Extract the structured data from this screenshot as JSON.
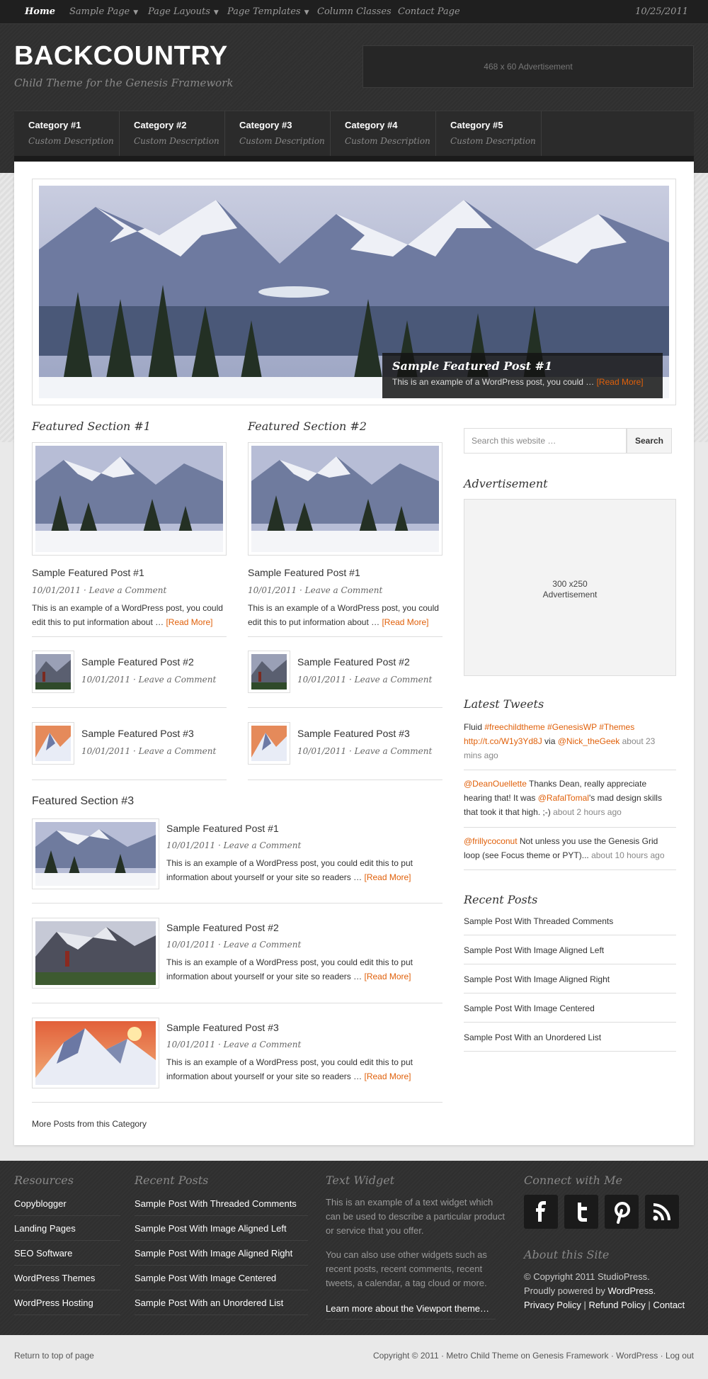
{
  "topnav": {
    "items": [
      {
        "label": "Home",
        "dropdown": false
      },
      {
        "label": "Sample Page",
        "dropdown": true
      },
      {
        "label": "Page Layouts",
        "dropdown": true
      },
      {
        "label": "Page Templates",
        "dropdown": true
      },
      {
        "label": "Column Classes",
        "dropdown": false
      },
      {
        "label": "Contact Page",
        "dropdown": false
      }
    ],
    "date": "10/25/2011"
  },
  "header": {
    "title": "BACKCOUNTRY",
    "description": "Child Theme for the Genesis Framework",
    "ad": "468 x 60 Advertisement"
  },
  "catnav": [
    {
      "title": "Category #1",
      "desc": "Custom Description"
    },
    {
      "title": "Category #2",
      "desc": "Custom Description"
    },
    {
      "title": "Category #3",
      "desc": "Custom Description"
    },
    {
      "title": "Category #4",
      "desc": "Custom Description"
    },
    {
      "title": "Category #5",
      "desc": "Custom Description"
    }
  ],
  "slider": {
    "title": "Sample Featured Post #1",
    "excerpt": "This is an example of a WordPress post, you could …",
    "read_more": "[Read More]"
  },
  "featured1": {
    "heading": "Featured Section #1",
    "main": {
      "title": "Sample Featured Post #1",
      "date": "10/01/2011",
      "comment": "Leave a Comment",
      "excerpt1": "This is an example of a WordPress post, you could",
      "excerpt2": "edit this to put information about …",
      "read_more": "[Read More]"
    },
    "list": [
      {
        "title": "Sample Featured Post #2",
        "date": "10/01/2011",
        "comment": "Leave a Comment"
      },
      {
        "title": "Sample Featured Post #3",
        "date": "10/01/2011",
        "comment": "Leave a Comment"
      }
    ]
  },
  "featured2": {
    "heading": "Featured Section #2",
    "main": {
      "title": "Sample Featured Post #1",
      "date": "10/01/2011",
      "comment": "Leave a Comment",
      "excerpt1": "This is an example of a WordPress post, you could",
      "excerpt2": "edit this to put information about …",
      "read_more": "[Read More]"
    },
    "list": [
      {
        "title": "Sample Featured Post #2",
        "date": "10/01/2011",
        "comment": "Leave a Comment"
      },
      {
        "title": "Sample Featured Post #3",
        "date": "10/01/2011",
        "comment": "Leave a Comment"
      }
    ]
  },
  "featured3": {
    "heading": "Featured Section #3",
    "posts": [
      {
        "title": "Sample Featured Post #1",
        "date": "10/01/2011",
        "comment": "Leave a Comment",
        "excerpt1": "This is an example of a WordPress post, you could edit this to put",
        "excerpt2": "information about yourself or your site so readers …",
        "read_more": "[Read More]"
      },
      {
        "title": "Sample Featured Post #2",
        "date": "10/01/2011",
        "comment": "Leave a Comment",
        "excerpt1": "This is an example of a WordPress post, you could edit this to put",
        "excerpt2": "information about yourself or your site so readers …",
        "read_more": "[Read More]"
      },
      {
        "title": "Sample Featured Post #3",
        "date": "10/01/2011",
        "comment": "Leave a Comment",
        "excerpt1": "This is an example of a WordPress post, you could edit this to put",
        "excerpt2": "information about yourself or your site so readers …",
        "read_more": "[Read More]"
      }
    ],
    "more": "More Posts from this Category"
  },
  "sidebar": {
    "search_placeholder": "Search this website …",
    "search_button": "Search",
    "ad_heading": "Advertisement",
    "ad_line1": "300 x250",
    "ad_line2": "Advertisement",
    "tweets_heading": "Latest Tweets",
    "tweets": [
      {
        "p1": "Fluid ",
        "l1": "#freechildtheme #GenesisWP #Themes",
        "l2": "http://t.co/W1y3Yd8J",
        "p2": " via ",
        "l3": "@Nick_theGeek",
        "ago1": " about 23",
        "ago2": "mins ago"
      },
      {
        "l1": "@DeanOuellette",
        "p1": " Thanks Dean, really appreciate",
        "p2": "hearing that! It was ",
        "l2": "@RafalTomal",
        "p3": "'s mad design skills",
        "p4": "that took it that high. ;-)",
        "ago": " about 2 hours ago"
      },
      {
        "l1": "@frillycoconut",
        "p1": " Not unless you use the Genesis Grid",
        "p2": "loop (see Focus theme or PYT)...",
        "ago": " about 10 hours ago"
      }
    ],
    "recent_heading": "Recent Posts",
    "recent": [
      "Sample Post With Threaded Comments",
      "Sample Post With Image Aligned Left",
      "Sample Post With Image Aligned Right",
      "Sample Post With Image Centered",
      "Sample Post With an Unordered List"
    ]
  },
  "footer": {
    "resources_heading": "Resources",
    "resources": [
      "Copyblogger",
      "Landing Pages",
      "SEO Software",
      "WordPress Themes",
      "WordPress Hosting"
    ],
    "recent_heading": "Recent Posts",
    "recent": [
      "Sample Post With Threaded Comments",
      "Sample Post With Image Aligned Left",
      "Sample Post With Image Aligned Right",
      "Sample Post With Image Centered",
      "Sample Post With an Unordered List"
    ],
    "text_heading": "Text Widget",
    "text1": "This is an example of a text widget which can be used to describe a particular product or service that you offer.",
    "text2": "You can also use other widgets such as recent posts, recent comments, recent tweets, a calendar, a tag cloud or more.",
    "text_link": "Learn more about the Viewport theme…",
    "connect_heading": "Connect with Me",
    "social": [
      "facebook-icon",
      "twitter-icon",
      "pinterest-icon",
      "rss-icon"
    ],
    "about_heading": "About this Site",
    "copyright": "© Copyright 2011 StudioPress.",
    "powered": "Proudly powered by ",
    "wordpress": "WordPress",
    "privacy": "Privacy Policy",
    "refund": "Refund Policy",
    "contact": "Contact"
  },
  "bottom": {
    "top_link": "Return to top of page",
    "copyright": "Copyright © 2011 · Metro Child Theme on Genesis Framework · WordPress · Log out"
  },
  "colors": {
    "accent": "#e0600a",
    "dark": "#2f2f2f",
    "panel": "#ffffff"
  }
}
